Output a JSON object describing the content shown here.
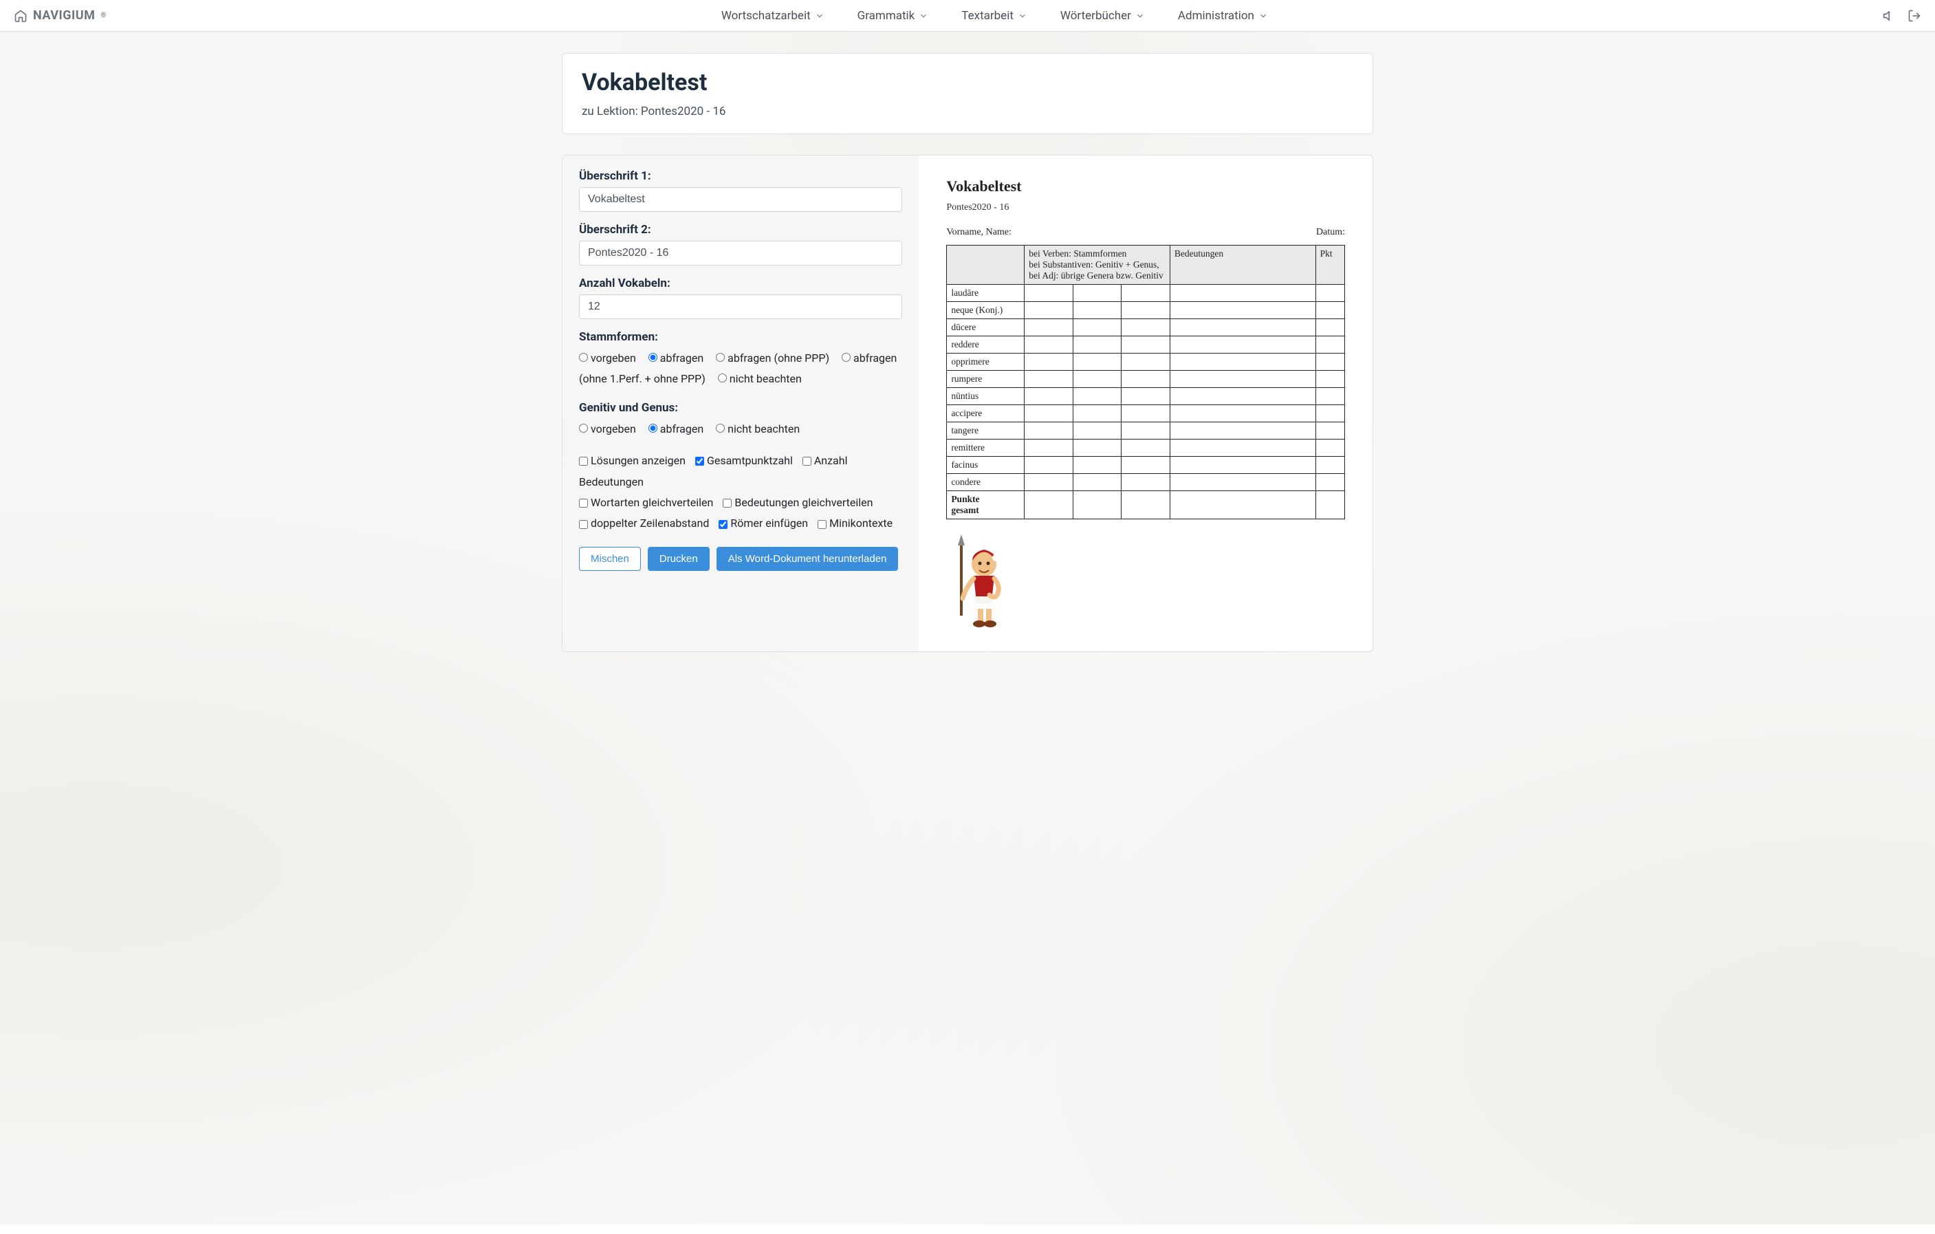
{
  "brand": "NAVIGIUM",
  "brand_sup": "®",
  "nav": {
    "items": [
      "Wortschatzarbeit",
      "Grammatik",
      "Textarbeit",
      "Wörterbücher",
      "Administration"
    ]
  },
  "header": {
    "title": "Vokabeltest",
    "subtitle": "zu Lektion: Pontes2020 - 16"
  },
  "form": {
    "heading1_label": "Überschrift 1:",
    "heading1_value": "Vokabeltest",
    "heading2_label": "Überschrift 2:",
    "heading2_value": "Pontes2020 - 16",
    "count_label": "Anzahl Vokabeln:",
    "count_value": "12",
    "stammformen_label": "Stammformen:",
    "stammformen_options": [
      "vorgeben",
      "abfragen",
      "abfragen (ohne PPP)",
      "abfragen (ohne 1.Perf. + ohne PPP)",
      "nicht beachten"
    ],
    "genitiv_label": "Genitiv und Genus:",
    "genitiv_options": [
      "vorgeben",
      "abfragen",
      "nicht beachten"
    ],
    "checkboxes": [
      {
        "label": "Lösungen anzeigen",
        "checked": false
      },
      {
        "label": "Gesamtpunktzahl",
        "checked": true
      },
      {
        "label": "Anzahl Bedeutungen",
        "checked": false
      },
      {
        "label": "Wortarten gleichverteilen",
        "checked": false
      },
      {
        "label": "Bedeutungen gleichverteilen",
        "checked": false
      },
      {
        "label": "doppelter Zeilenabstand",
        "checked": false
      },
      {
        "label": "Römer einfügen",
        "checked": true
      },
      {
        "label": "Minikontexte",
        "checked": false
      }
    ],
    "buttons": {
      "mix": "Mischen",
      "print": "Drucken",
      "word": "Als Word-Dokument herunterladen"
    }
  },
  "preview": {
    "title": "Vokabeltest",
    "subtitle": "Pontes2020 - 16",
    "name_label": "Vorname, Name:",
    "date_label": "Datum:",
    "headers": {
      "stems": "bei Verben: Stammformen\nbei Substantiven: Genitiv + Genus,\nbei Adj: übrige Genera bzw. Genitiv",
      "meanings": "Bedeutungen",
      "points": "Pkt"
    },
    "words": [
      "laudāre",
      "neque (Konj.)",
      "dūcere",
      "reddere",
      "opprimere",
      "rumpere",
      "nūntius",
      "accipere",
      "tangere",
      "remittere",
      "facinus",
      "condere"
    ],
    "total_label": "Punkte gesamt"
  }
}
